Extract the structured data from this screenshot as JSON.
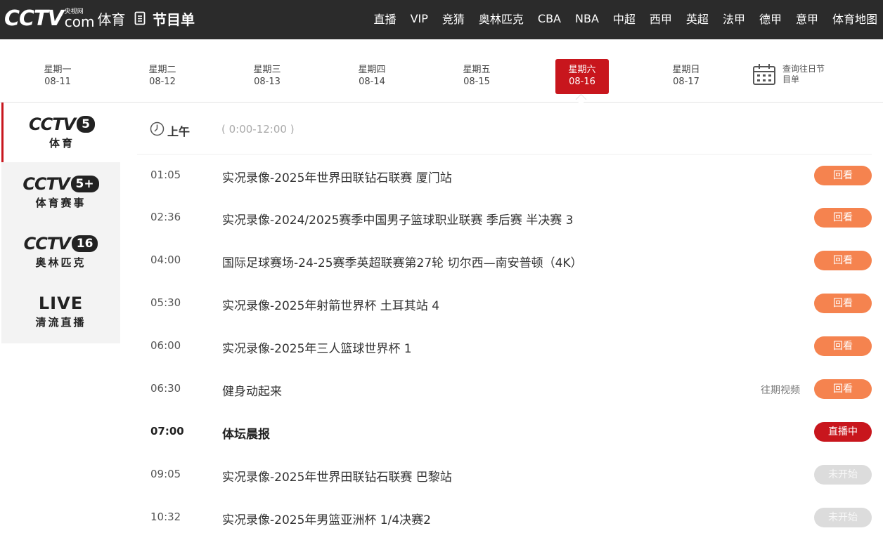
{
  "header": {
    "logo_text": "CCTV",
    "logo_small": "央视网",
    "logo_com": "com",
    "logo_sports": "体育",
    "page_title": "节目单",
    "nav": [
      "直播",
      "VIP",
      "竞猜",
      "奥林匹克",
      "CBA",
      "NBA",
      "中超",
      "西甲",
      "英超",
      "法甲",
      "德甲",
      "意甲",
      "体育地图"
    ]
  },
  "days": [
    {
      "week": "星期一",
      "date": "08-11",
      "active": false
    },
    {
      "week": "星期二",
      "date": "08-12",
      "active": false
    },
    {
      "week": "星期三",
      "date": "08-13",
      "active": false
    },
    {
      "week": "星期四",
      "date": "08-14",
      "active": false
    },
    {
      "week": "星期五",
      "date": "08-15",
      "active": false
    },
    {
      "week": "星期六",
      "date": "08-16",
      "active": true
    },
    {
      "week": "星期日",
      "date": "08-17",
      "active": false
    }
  ],
  "history": {
    "label_line1": "查询往日节",
    "label_line2": "目单",
    "icon": "calendar-icon"
  },
  "channels": [
    {
      "brand": "CCTV",
      "number": "5",
      "sub": "体育",
      "active": true
    },
    {
      "brand": "CCTV",
      "number": "5+",
      "sub": "体育赛事",
      "active": false
    },
    {
      "brand": "CCTV",
      "number": "16",
      "sub": "奥林匹克",
      "active": false
    },
    {
      "brand": "LIVE",
      "number": "",
      "sub": "清流直播",
      "active": false
    }
  ],
  "section": {
    "label": "上午",
    "range": "( 0:00-12:00 )",
    "icon": "clock-icon"
  },
  "programs": [
    {
      "time": "01:05",
      "title": "实况录像-2025年世界田联钻石联赛 厦门站",
      "extra": "",
      "status": "回看",
      "kind": "replay"
    },
    {
      "time": "02:36",
      "title": "实况录像-2024/2025赛季中国男子篮球职业联赛 季后赛 半决赛 3",
      "extra": "",
      "status": "回看",
      "kind": "replay"
    },
    {
      "time": "04:00",
      "title": "国际足球赛场-24-25赛季英超联赛第27轮 切尔西—南安普顿（4K）",
      "extra": "",
      "status": "回看",
      "kind": "replay"
    },
    {
      "time": "05:30",
      "title": "实况录像-2025年射箭世界杯 土耳其站 4",
      "extra": "",
      "status": "回看",
      "kind": "replay"
    },
    {
      "time": "06:00",
      "title": "实况录像-2025年三人篮球世界杯 1",
      "extra": "",
      "status": "回看",
      "kind": "replay"
    },
    {
      "time": "06:30",
      "title": "健身动起来",
      "extra": "往期视频",
      "status": "回看",
      "kind": "replay"
    },
    {
      "time": "07:00",
      "title": "体坛晨报",
      "extra": "",
      "status": "直播中",
      "kind": "onair"
    },
    {
      "time": "09:05",
      "title": "实况录像-2025年世界田联钻石联赛 巴黎站",
      "extra": "",
      "status": "未开始",
      "kind": "pending"
    },
    {
      "time": "10:32",
      "title": "实况录像-2025年男篮亚洲杯 1/4决赛2",
      "extra": "",
      "status": "未开始",
      "kind": "pending"
    }
  ],
  "colors": {
    "accent": "#c8161d",
    "replay": "#f5834f",
    "pending": "#dcdcdc",
    "topbar": "#2b2b2b"
  }
}
